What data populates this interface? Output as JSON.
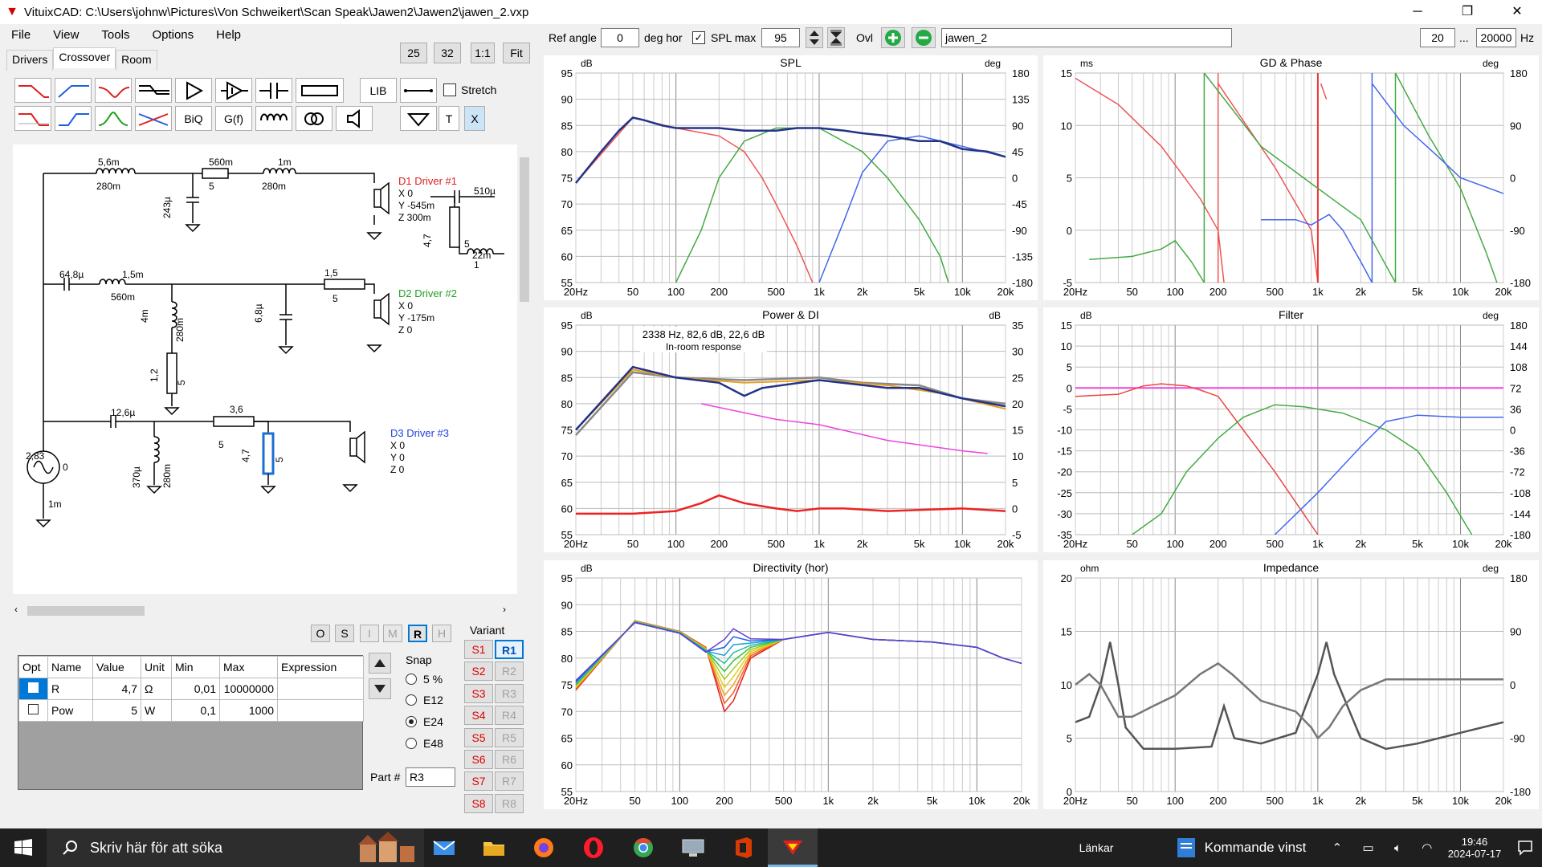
{
  "window": {
    "title": "VituixCAD: C:\\Users\\johnw\\Pictures\\Von Schweikert\\Scan Speak\\Jawen2\\Jawen2\\jawen_2.vxp",
    "min": "─",
    "max": "❐",
    "close": "✕"
  },
  "menu": [
    "File",
    "View",
    "Tools",
    "Options",
    "Help"
  ],
  "tabs": [
    "Drivers",
    "Crossover",
    "Room"
  ],
  "top_buttons": {
    "b25": "25",
    "b32": "32",
    "one": "1:1",
    "fit": "Fit"
  },
  "toolbar": {
    "lib": "LIB",
    "biq": "BiQ",
    "gf": "G(f)",
    "t": "T",
    "x": "X",
    "stretch": "Stretch"
  },
  "header": {
    "ref_angle_label": "Ref angle",
    "ref_angle_value": "0",
    "deg_hor": "deg hor",
    "spl_max_label": "SPL max",
    "spl_max_value": "95",
    "ovl": "Ovl",
    "name_value": "jawen_2",
    "f_low": "20",
    "dots": "...",
    "f_high": "20000",
    "hz": "Hz"
  },
  "schematic": {
    "labels": [
      {
        "t": "5,6m"
      },
      {
        "t": "280m"
      },
      {
        "t": "560m"
      },
      {
        "t": "5"
      },
      {
        "t": "1m"
      },
      {
        "t": "280m"
      },
      {
        "t": "243µ"
      },
      {
        "t": "510µ"
      },
      {
        "t": "4,7"
      },
      {
        "t": "5"
      },
      {
        "t": "22m"
      },
      {
        "t": "1"
      },
      {
        "t": "64,8µ"
      },
      {
        "t": "1,5m"
      },
      {
        "t": "560m"
      },
      {
        "t": "1,5"
      },
      {
        "t": "5"
      },
      {
        "t": "4m"
      },
      {
        "t": "280m"
      },
      {
        "t": "6,8µ"
      },
      {
        "t": "1,2"
      },
      {
        "t": "5"
      },
      {
        "t": "12,6µ"
      },
      {
        "t": "3,6"
      },
      {
        "t": "5"
      },
      {
        "t": "370µ"
      },
      {
        "t": "280m"
      },
      {
        "t": "4,7"
      },
      {
        "t": "5"
      },
      {
        "t": "2,83"
      },
      {
        "t": "0"
      },
      {
        "t": "1m"
      }
    ],
    "drivers": [
      {
        "name": "D1 Driver #1",
        "color": "#e02020",
        "x": "X 0",
        "y": "Y -545m",
        "z": "Z 300m"
      },
      {
        "name": "D2 Driver #2",
        "color": "#20a020",
        "x": "X 0",
        "y": "Y -175m",
        "z": "Z 0"
      },
      {
        "name": "D3 Driver #3",
        "color": "#2040e0",
        "x": "X 0",
        "y": "Y 0",
        "z": "Z 0"
      }
    ]
  },
  "state_buttons": [
    "O",
    "S",
    "I",
    "M",
    "R",
    "H"
  ],
  "param_table": {
    "headers": [
      "Opt",
      "Name",
      "Value",
      "Unit",
      "Min",
      "Max",
      "Expression"
    ],
    "rows": [
      {
        "name": "R",
        "value": "4,7",
        "unit": "Ω",
        "min": "0,01",
        "max": "10000000",
        "expr": ""
      },
      {
        "name": "Pow",
        "value": "5",
        "unit": "W",
        "min": "0,1",
        "max": "1000",
        "expr": ""
      }
    ]
  },
  "snap": {
    "label": "Snap",
    "options": [
      "5 %",
      "E12",
      "E24",
      "E48"
    ],
    "selected": "E24"
  },
  "part": {
    "label": "Part #",
    "value": "R3"
  },
  "variant": {
    "label": "Variant",
    "left": [
      "S1",
      "S2",
      "S3",
      "S4",
      "S5",
      "S6",
      "S7",
      "S8"
    ],
    "right": [
      "R1",
      "R2",
      "R3",
      "R4",
      "R5",
      "R6",
      "R7",
      "R8"
    ],
    "active": "R1"
  },
  "charts": {
    "spl": {
      "title": "SPL",
      "yunit": "dB",
      "y2unit": "deg",
      "yticks": [
        "95",
        "90",
        "85",
        "80",
        "75",
        "70",
        "65",
        "60",
        "55"
      ],
      "y2ticks": [
        "180",
        "135",
        "90",
        "45",
        "0",
        "-45",
        "-90",
        "-135",
        "-180"
      ],
      "xticks": [
        "20Hz",
        "50",
        "100",
        "200",
        "500",
        "1k",
        "2k",
        "5k",
        "10k",
        "20k"
      ]
    },
    "gd": {
      "title": "GD & Phase",
      "yunit": "ms",
      "y2unit": "deg",
      "yticks": [
        "15",
        "10",
        "5",
        "0",
        "-5"
      ],
      "y2ticks": [
        "180",
        "90",
        "0",
        "-90",
        "-180"
      ],
      "xticks": [
        "20Hz",
        "50",
        "100",
        "200",
        "500",
        "1k",
        "2k",
        "5k",
        "10k",
        "20k"
      ]
    },
    "power": {
      "title": "Power & DI",
      "yunit": "dB",
      "y2unit": "dB",
      "yticks": [
        "95",
        "90",
        "85",
        "80",
        "75",
        "70",
        "65",
        "60",
        "55"
      ],
      "y2ticks": [
        "35",
        "30",
        "25",
        "20",
        "15",
        "10",
        "5",
        "0",
        "-5"
      ],
      "xticks": [
        "20Hz",
        "50",
        "100",
        "200",
        "500",
        "1k",
        "2k",
        "5k",
        "10k",
        "20k"
      ],
      "note1": "2338 Hz, 82,6 dB, 22,6 dB",
      "note2": "In-room response"
    },
    "filter": {
      "title": "Filter",
      "yunit": "dB",
      "y2unit": "deg",
      "yticks": [
        "15",
        "10",
        "5",
        "0",
        "-5",
        "-10",
        "-15",
        "-20",
        "-25",
        "-30",
        "-35"
      ],
      "y2ticks": [
        "180",
        "144",
        "108",
        "72",
        "36",
        "0",
        "-36",
        "-72",
        "-108",
        "-144",
        "-180"
      ],
      "xticks": [
        "20Hz",
        "50",
        "100",
        "200",
        "500",
        "1k",
        "2k",
        "5k",
        "10k",
        "20k"
      ]
    },
    "directivity": {
      "title": "Directivity (hor)",
      "yunit": "dB",
      "yticks": [
        "95",
        "90",
        "85",
        "80",
        "75",
        "70",
        "65",
        "60",
        "55"
      ],
      "xticks": [
        "20Hz",
        "50",
        "100",
        "200",
        "500",
        "1k",
        "2k",
        "5k",
        "10k",
        "20k"
      ]
    },
    "impedance": {
      "title": "Impedance",
      "yunit": "ohm",
      "y2unit": "deg",
      "yticks": [
        "20",
        "15",
        "10",
        "5",
        "0"
      ],
      "y2ticks": [
        "180",
        "90",
        "0",
        "-90",
        "-180"
      ],
      "xticks": [
        "20Hz",
        "50",
        "100",
        "200",
        "500",
        "1k",
        "2k",
        "5k",
        "10k",
        "20k"
      ]
    }
  },
  "taskbar": {
    "search": "Skriv här för att söka",
    "links": "Länkar",
    "weather": "Kommande vinst",
    "time": "19:46",
    "date": "2024-07-17"
  }
}
